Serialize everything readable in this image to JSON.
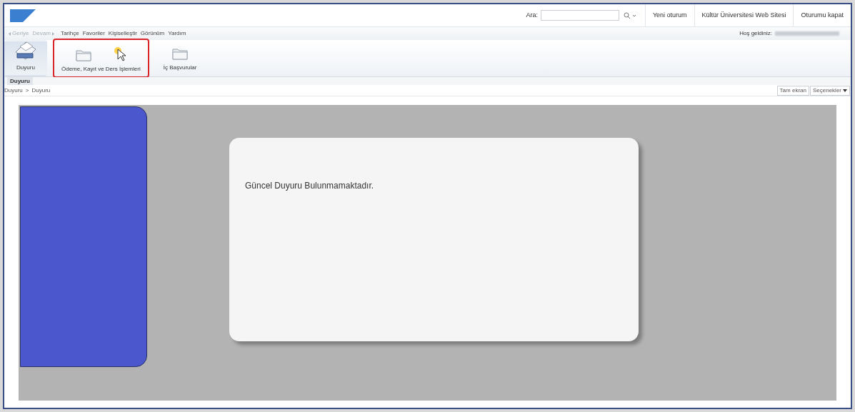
{
  "header": {
    "search_label": "Ara:",
    "links": [
      "Yeni oturum",
      "Kültür Üniversitesi Web Sitesi",
      "Oturumu kapat"
    ],
    "welcome": "Hoş geldiniz:"
  },
  "nav": [
    {
      "label": "Geriye",
      "kind": "back",
      "disabled": true
    },
    {
      "label": "Devam",
      "kind": "forward",
      "disabled": true
    }
  ],
  "menu": [
    "Tarihçe",
    "Favoriler",
    "Kişiselleştir",
    "Görünüm",
    "Yardım"
  ],
  "toolbar": [
    {
      "label": "Duyuru",
      "kind": "announcement",
      "selected": true,
      "highlighted": false
    },
    {
      "label": "Ödeme, Kayıt ve Ders İşlemleri",
      "kind": "folder",
      "selected": false,
      "highlighted": true
    },
    {
      "label": "İç Başvurular",
      "kind": "folder",
      "selected": false,
      "highlighted": false
    }
  ],
  "subtabs": [
    {
      "label": "Duyuru",
      "selected": true
    }
  ],
  "breadcrumb": [
    "Duyuru",
    "Duyuru"
  ],
  "breadcrumb_separator": ">",
  "page_buttons": [
    "Tam ekran",
    "Seçenekler"
  ],
  "message": "Güncel Duyuru Bulunmamaktadır."
}
